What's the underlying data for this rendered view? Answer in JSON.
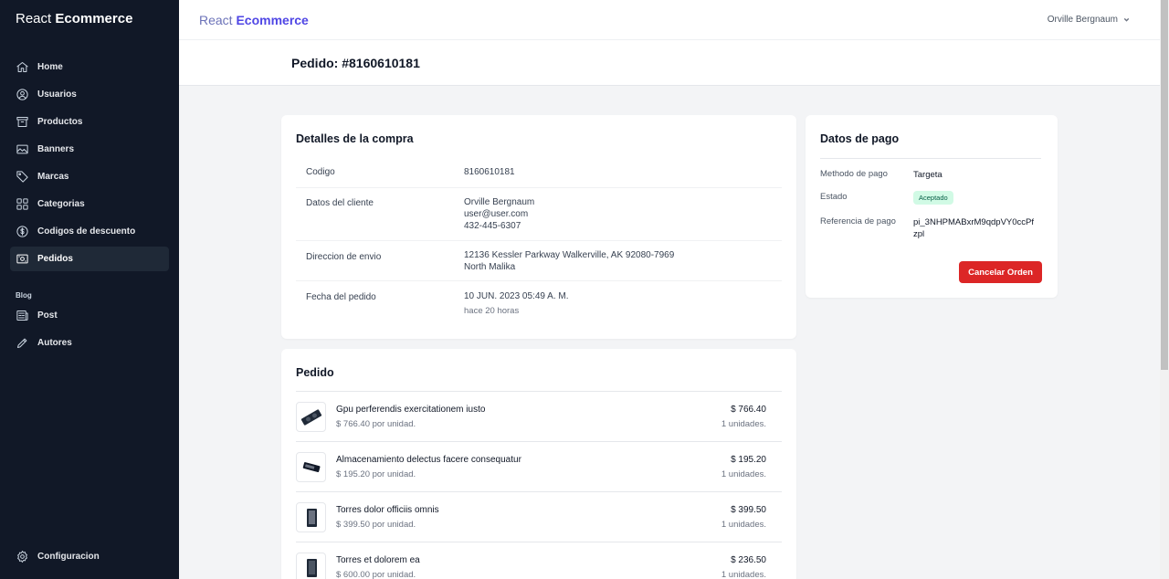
{
  "sidebar": {
    "brand_light": "React",
    "brand_bold": "Ecommerce",
    "items": [
      {
        "label": "Home",
        "icon": "home-icon"
      },
      {
        "label": "Usuarios",
        "icon": "user-circle-icon"
      },
      {
        "label": "Productos",
        "icon": "archive-box-icon"
      },
      {
        "label": "Banners",
        "icon": "image-icon"
      },
      {
        "label": "Marcas",
        "icon": "tag-icon"
      },
      {
        "label": "Categorias",
        "icon": "grid-icon"
      },
      {
        "label": "Codigos de descuento",
        "icon": "dollar-circle-icon"
      },
      {
        "label": "Pedidos",
        "icon": "cash-icon",
        "active": true
      }
    ],
    "blog_label": "Blog",
    "blog_items": [
      {
        "label": "Post",
        "icon": "newspaper-icon"
      },
      {
        "label": "Autores",
        "icon": "pencil-icon"
      }
    ],
    "settings_label": "Configuracion"
  },
  "topbar": {
    "brand_light": "React",
    "brand_bold": "Ecommerce",
    "user_name": "Orville Bergnaum"
  },
  "page": {
    "title": "Pedido: #8160610181"
  },
  "details": {
    "title": "Detalles de la compra",
    "code_label": "Codigo",
    "code_value": "8160610181",
    "client_label": "Datos del cliente",
    "client_name": "Orville Bergnaum",
    "client_email": "user@user.com",
    "client_phone": "432-445-6307",
    "address_label": "Direccion de envio",
    "address_line1": "12136 Kessler Parkway Walkerville, AK 92080-7969",
    "address_line2": "North Malika",
    "date_label": "Fecha del pedido",
    "date_value": "10 JUN. 2023 05:49 A. M.",
    "date_relative": "hace 20 horas"
  },
  "payment": {
    "title": "Datos de pago",
    "method_label": "Methodo de pago",
    "method_value": "Targeta",
    "status_label": "Estado",
    "status_value": "Aceptado",
    "reference_label": "Referencia de pago",
    "reference_line1": "pi_3NHPMABxrM9qdpVY0ccPf",
    "reference_line2": "zpl",
    "cancel_label": "Cancelar Orden",
    "colors": {
      "cancel": "#dc2626",
      "badge_bg": "#d1fae5",
      "badge_text": "#065f46"
    }
  },
  "order": {
    "title": "Pedido",
    "items": [
      {
        "name": "Gpu perferendis exercitationem iusto",
        "unit": "$ 766.40 por unidad.",
        "price": "$ 766.40",
        "qty": "1 unidades.",
        "icon": "gpu-icon"
      },
      {
        "name": "Almacenamiento delectus facere consequatur",
        "unit": "$ 195.20 por unidad.",
        "price": "$ 195.20",
        "qty": "1 unidades.",
        "icon": "storage-icon"
      },
      {
        "name": "Torres dolor officiis omnis",
        "unit": "$ 399.50 por unidad.",
        "price": "$ 399.50",
        "qty": "1 unidades.",
        "icon": "pc-tower-icon"
      },
      {
        "name": "Torres et dolorem ea",
        "unit": "$ 600.00 por unidad.",
        "price": "$ 236.50",
        "qty": "1 unidades.",
        "icon": "pc-tower-icon"
      }
    ]
  }
}
